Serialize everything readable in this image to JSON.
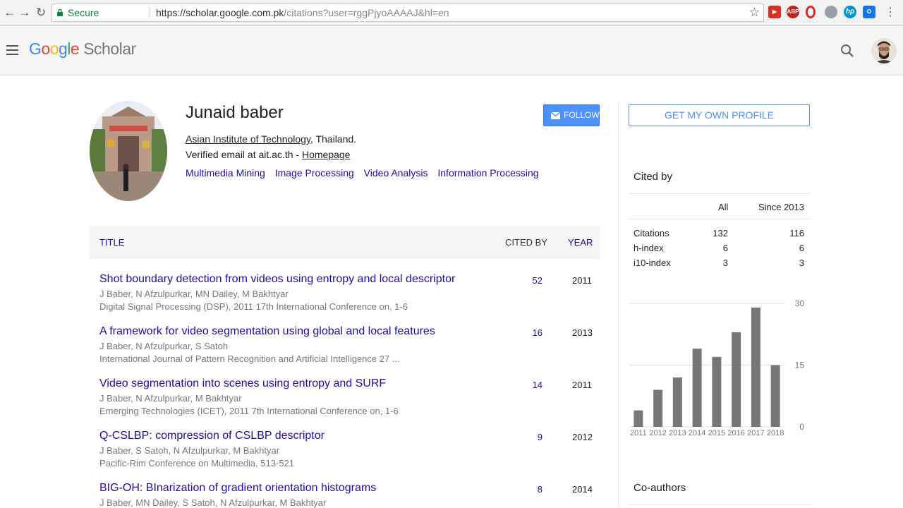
{
  "browser": {
    "secure_label": "Secure",
    "url_host": "https://scholar.google.com.pk",
    "url_path": "/citations?user=rggPjyoAAAAJ&hl=en",
    "ext_abp": "ABP"
  },
  "header": {
    "logo_letters": [
      "G",
      "o",
      "o",
      "g",
      "l",
      "e"
    ],
    "logo_colors": [
      "#4285f4",
      "#ea4335",
      "#fbbc05",
      "#4285f4",
      "#34a853",
      "#ea4335"
    ],
    "logo_product": "Scholar"
  },
  "profile": {
    "name": "Junaid baber",
    "affiliation_link": "Asian Institute of Technology",
    "affiliation_rest": ", Thailand.",
    "email_text": "Verified email at ait.ac.th - ",
    "homepage_link": "Homepage",
    "interests": [
      "Multimedia Mining",
      "Image Processing",
      "Video Analysis",
      "Information Processing"
    ],
    "follow_label": "FOLLOW"
  },
  "table": {
    "headers": {
      "title": "TITLE",
      "cited_by": "CITED BY",
      "year": "YEAR"
    },
    "rows": [
      {
        "title": "Shot boundary detection from videos using entropy and local descriptor",
        "authors": "J Baber, N Afzulpurkar, MN Dailey, M Bakhtyar",
        "venue": "Digital Signal Processing (DSP), 2011 17th International Conference on, 1-6",
        "cited": "52",
        "year": "2011"
      },
      {
        "title": "A framework for video segmentation using global and local features",
        "authors": "J Baber, N Afzulpurkar, S Satoh",
        "venue": "International Journal of Pattern Recognition and Artificial Intelligence 27 ...",
        "cited": "16",
        "year": "2013"
      },
      {
        "title": "Video segmentation into scenes using entropy and SURF",
        "authors": "J Baber, N Afzulpurkar, M Bakhtyar",
        "venue": "Emerging Technologies (ICET), 2011 7th International Conference on, 1-6",
        "cited": "14",
        "year": "2011"
      },
      {
        "title": "Q-CSLBP: compression of CSLBP descriptor",
        "authors": "J Baber, S Satoh, N Afzulpurkar, M Bakhtyar",
        "venue": "Pacific-Rim Conference on Multimedia, 513-521",
        "cited": "9",
        "year": "2012"
      },
      {
        "title": "BIG-OH: BInarization of gradient orientation histograms",
        "authors": "J Baber, MN Dailey, S Satoh, N Afzulpurkar, M Bakhtyar",
        "venue": "",
        "cited": "8",
        "year": "2014"
      }
    ]
  },
  "sidebar": {
    "get_profile_label": "GET MY OWN PROFILE",
    "cited_by_title": "Cited by",
    "col_all": "All",
    "col_since": "Since 2013",
    "stats": [
      {
        "label": "Citations",
        "all": "132",
        "since": "116"
      },
      {
        "label": "h-index",
        "all": "6",
        "since": "6"
      },
      {
        "label": "i10-index",
        "all": "3",
        "since": "3"
      }
    ],
    "coauthors_title": "Co-authors"
  },
  "chart_data": {
    "type": "bar",
    "categories": [
      "2011",
      "2012",
      "2013",
      "2014",
      "2015",
      "2016",
      "2017",
      "2018"
    ],
    "values": [
      4,
      9,
      12,
      19,
      17,
      23,
      29,
      15
    ],
    "ylim": [
      0,
      30
    ],
    "yticks": [
      0,
      15,
      30
    ],
    "ytick_labels": [
      "0",
      "15",
      "30"
    ],
    "grid": true,
    "bar_color": "#777777"
  }
}
